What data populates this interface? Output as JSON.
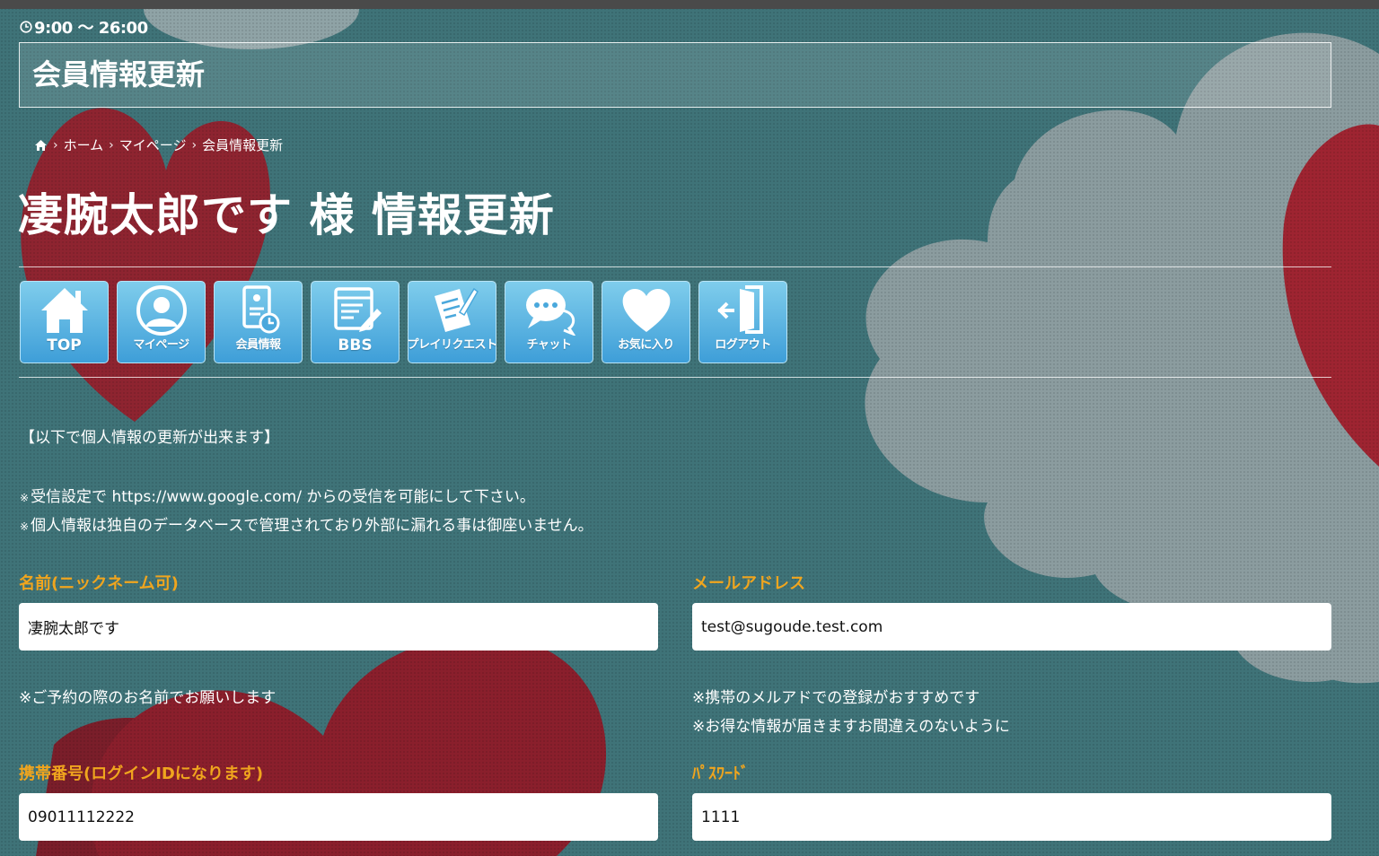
{
  "header": {
    "hours": "9:00 〜 26:00",
    "section_title": "会員情報更新"
  },
  "breadcrumb": {
    "items": [
      "ホーム",
      "マイページ",
      "会員情報更新"
    ]
  },
  "page": {
    "title": "凄腕太郎です 様 情報更新"
  },
  "nav": {
    "items": [
      {
        "label": "TOP",
        "icon": "house-icon"
      },
      {
        "label": "マイページ",
        "icon": "user-icon"
      },
      {
        "label": "会員情報",
        "icon": "member-info-icon"
      },
      {
        "label": "BBS",
        "icon": "bbs-icon"
      },
      {
        "label": "プレイリクエスト",
        "icon": "request-icon"
      },
      {
        "label": "チャット",
        "icon": "chat-icon"
      },
      {
        "label": "お気に入り",
        "icon": "heart-icon"
      },
      {
        "label": "ログアウト",
        "icon": "logout-icon"
      }
    ]
  },
  "info": {
    "intro": "【以下で個人情報の更新が出来ます】",
    "note_mark": "※",
    "note1": "受信設定で https://www.google.com/ からの受信を可能にして下さい。",
    "note2": "個人情報は独自のデータベースで管理されており外部に漏れる事は御座いません。"
  },
  "form": {
    "name": {
      "label": "名前(ニックネーム可)",
      "value": "凄腕太郎です",
      "hint": "※ご予約の際のお名前でお願いします"
    },
    "email": {
      "label": "メールアドレス",
      "value": "test@sugoude.test.com",
      "hint1": "※携帯のメルアドでの登録がおすすめです",
      "hint2": "※お得な情報が届きますお間違えのないように"
    },
    "phone": {
      "label": "携帯番号(ログインIDになります)",
      "value": "09011112222"
    },
    "password": {
      "label": "ﾊﾟｽﾜｰﾄﾞ",
      "value": "1111"
    }
  },
  "colors": {
    "label_accent": "#f0a51e",
    "nav_button": "#5db6e3",
    "background_teal": "#3a6b70",
    "heart_red": "#a0222f"
  }
}
